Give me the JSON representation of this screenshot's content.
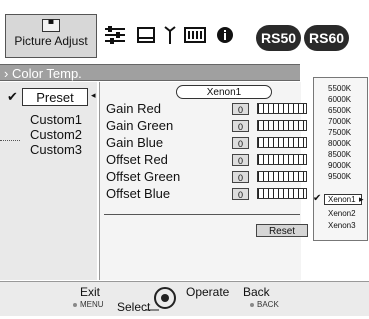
{
  "toolbar": {
    "picture_adjust_label": "Picture Adjust",
    "badges": [
      "RS50",
      "RS60"
    ]
  },
  "header": {
    "title": "Color Temp."
  },
  "left_panel": {
    "preset": "Preset",
    "items": [
      "Custom1",
      "Custom2",
      "Custom3"
    ]
  },
  "main": {
    "current_value": "Xenon1",
    "rows": [
      {
        "label": "Gain Red",
        "value": "0"
      },
      {
        "label": "Gain Green",
        "value": "0"
      },
      {
        "label": "Gain Blue",
        "value": "0"
      },
      {
        "label": "Offset Red",
        "value": "0"
      },
      {
        "label": "Offset Green",
        "value": "0"
      },
      {
        "label": "Offset Blue",
        "value": "0"
      }
    ],
    "reset_label": "Reset"
  },
  "dropdown": {
    "options": [
      "5500K",
      "6000K",
      "6500K",
      "7000K",
      "7500K",
      "8000K",
      "8500K",
      "9000K",
      "9500K"
    ],
    "selected": "Xenon1",
    "after": [
      "Xenon2",
      "Xenon3"
    ]
  },
  "footer": {
    "exit": "Exit",
    "menu": "MENU",
    "select": "Select",
    "operate": "Operate",
    "back": "Back",
    "back_key": "BACK"
  }
}
